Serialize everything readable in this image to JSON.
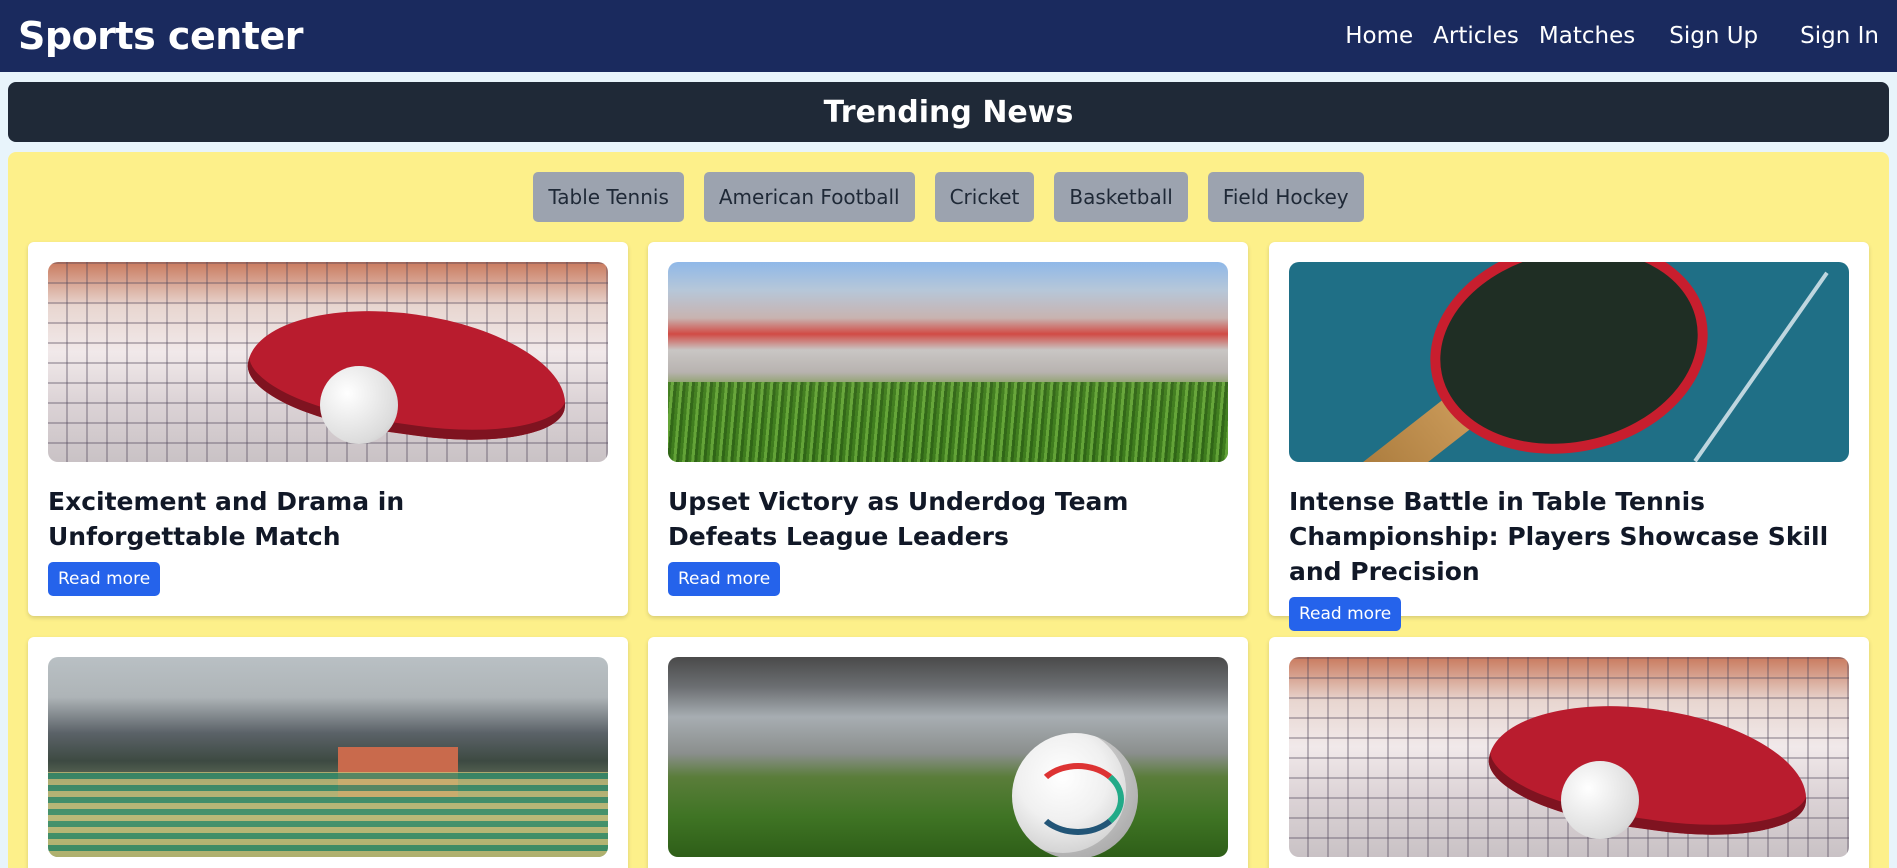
{
  "navbar": {
    "brand": "Sports center",
    "links": [
      "Home",
      "Articles",
      "Matches",
      "Sign Up",
      "Sign In"
    ]
  },
  "trending": {
    "title": "Trending News"
  },
  "filters": [
    "Table Tennis",
    "American Football",
    "Cricket",
    "Basketball",
    "Field Hockey"
  ],
  "cards": [
    {
      "title": "Excitement and Drama in Unforgettable Match",
      "button": "Read more",
      "image": "table-tennis-paddle-ball-photo"
    },
    {
      "title": "Upset Victory as Underdog Team Defeats League Leaders",
      "button": "Read more",
      "image": "stadium-grass-photo"
    },
    {
      "title": "Intense Battle in Table Tennis Championship: Players Showcase Skill and Precision",
      "button": "Read more",
      "image": "table-tennis-paddle-blue-photo"
    },
    {
      "title": "",
      "button": "",
      "image": "cricket-stadium-mountains-photo"
    },
    {
      "title": "",
      "button": "",
      "image": "football-stadium-ball-photo"
    },
    {
      "title": "",
      "button": "",
      "image": "table-tennis-paddle-ball-photo"
    }
  ],
  "colors": {
    "navbar": "#1a2a5e",
    "trending_bar": "#1f2937",
    "panel": "#fdf08a",
    "chip": "#9ca3af",
    "button": "#2563eb"
  }
}
